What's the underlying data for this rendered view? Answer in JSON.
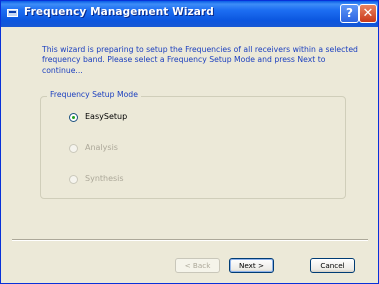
{
  "window": {
    "title": "Frequency Management Wizard",
    "help_label": "?",
    "close_label": "✕"
  },
  "intro_text": "This wizard is preparing to setup the Frequencies of all receivers within a selected frequency band. Please select a Frequency Setup Mode and press Next to continue...",
  "group": {
    "title": "Frequency Setup Mode",
    "options": [
      {
        "label": "EasySetup",
        "selected": true,
        "enabled": true
      },
      {
        "label": "Analysis",
        "selected": false,
        "enabled": false
      },
      {
        "label": "Synthesis",
        "selected": false,
        "enabled": false
      }
    ]
  },
  "buttons": {
    "back": "< Back",
    "next": "Next >",
    "cancel": "Cancel"
  },
  "colors": {
    "title_bar": "#0b56df",
    "text_accent": "#1b3fbf",
    "face": "#ece9d8"
  }
}
